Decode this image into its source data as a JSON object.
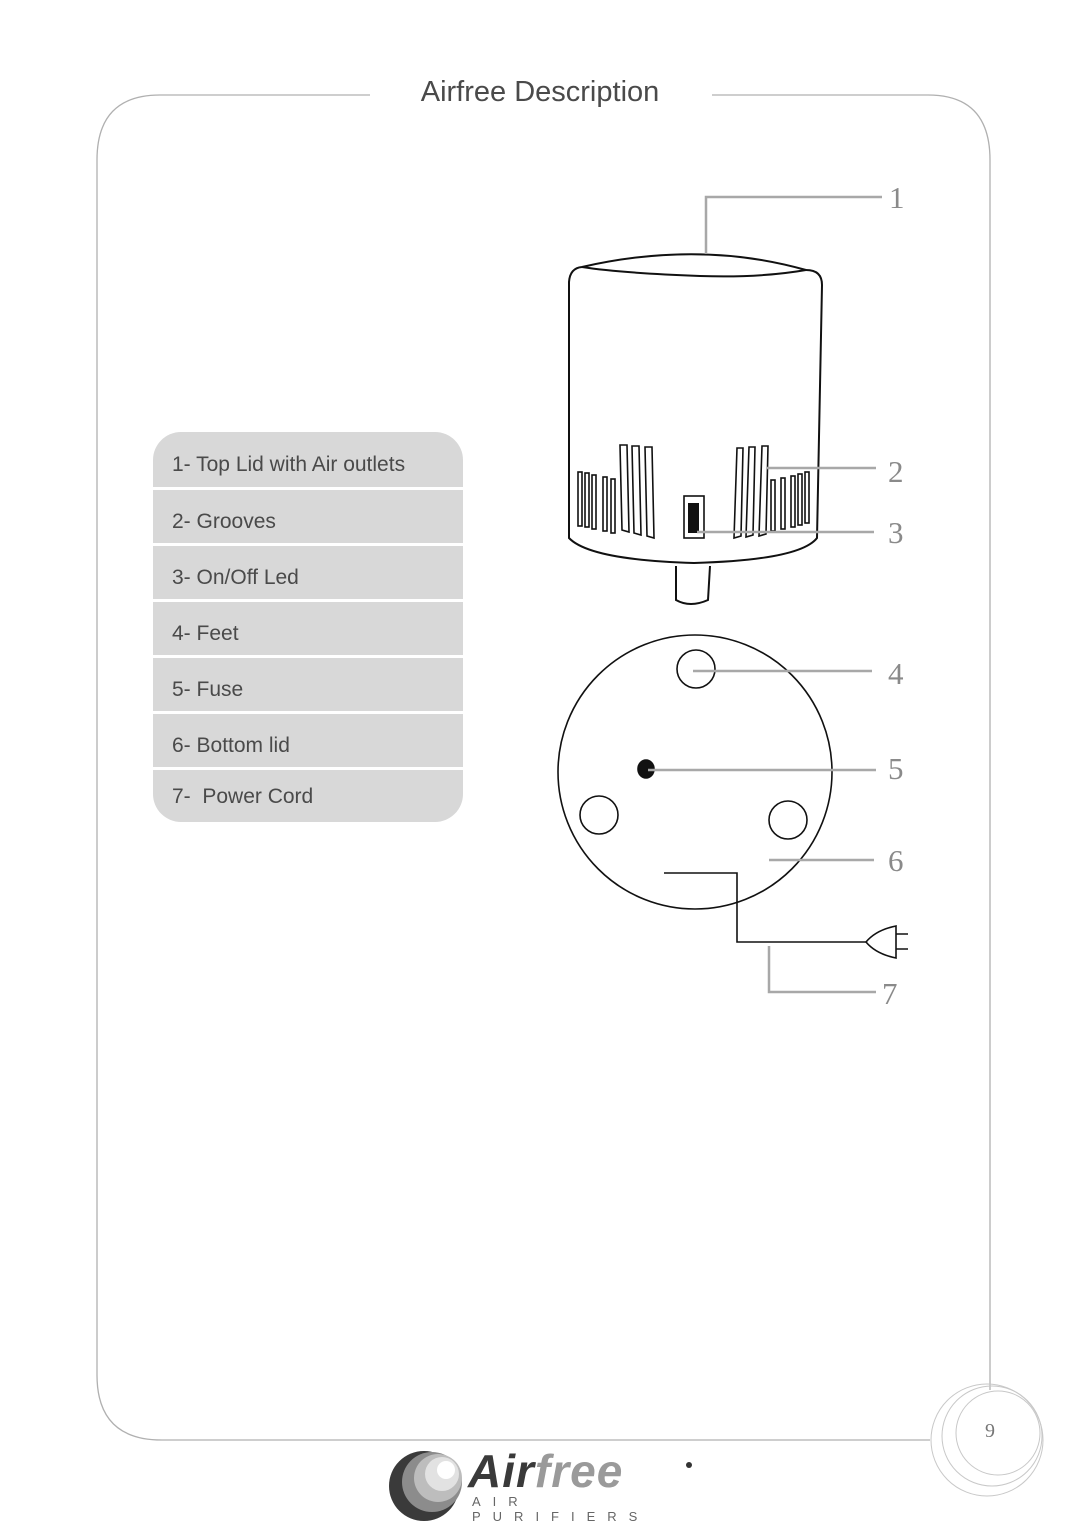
{
  "page": {
    "title": "Airfree Description",
    "page_number": "9"
  },
  "legend": {
    "items": [
      {
        "label": "1- Top Lid with Air outlets"
      },
      {
        "label": "2- Grooves"
      },
      {
        "label": "3- On/Off Led"
      },
      {
        "label": "4- Feet"
      },
      {
        "label": "5- Fuse"
      },
      {
        "label": "6- Bottom lid"
      },
      {
        "label": "7-  Power Cord"
      }
    ]
  },
  "callouts": [
    "1",
    "2",
    "3",
    "4",
    "5",
    "6",
    "7"
  ],
  "logo": {
    "brand_dark": "Air",
    "brand_light": "free",
    "tagline": "AIR PURIFIERS"
  },
  "colors": {
    "frame_line": "#b0b0b0",
    "legend_bg": "#d8d8d8",
    "leader_line": "#a8a8a8",
    "text": "#4a4a4a"
  }
}
